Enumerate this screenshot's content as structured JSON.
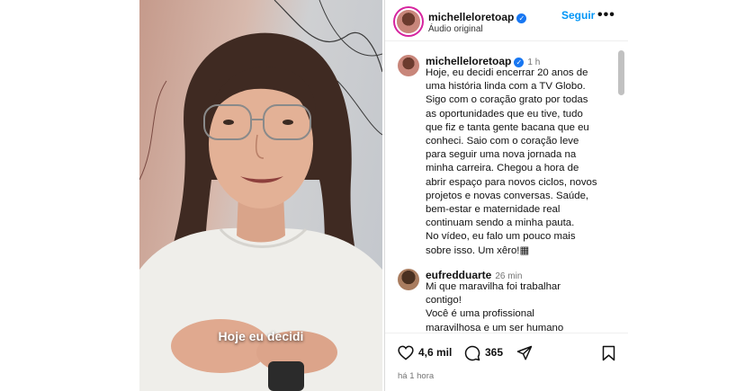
{
  "video": {
    "caption": "Hoje eu decidi"
  },
  "post": {
    "username": "michelleloretoap",
    "follow_label": "Seguir",
    "more_label": "•••",
    "audio_label": "Áudio original"
  },
  "caption": {
    "username": "michelleloretoap",
    "time": "1 h",
    "lines": [
      "Hoje, eu decidi encerrar 20 anos de",
      "uma história linda com a TV Globo.",
      "Sigo com o coração grato por todas",
      "as oportunidades que eu tive, tudo",
      "que fiz e tanta gente bacana que eu",
      "conheci. Saio com o coração leve",
      "para seguir uma nova jornada na",
      "minha carreira. Chegou a hora de",
      "abrir espaço para novos ciclos, novos",
      "projetos e novas conversas. Saúde,",
      "bem-estar e maternidade real",
      "continuam sendo a minha pauta.",
      "No vídeo, eu falo um pouco mais",
      "sobre isso. Um xêro!▦"
    ]
  },
  "comment": {
    "username": "eufredduarte",
    "time": "26 min",
    "lines": [
      "Mi que maravilha foi trabalhar",
      "contigo!",
      "Você é uma profissional",
      "maravilhosa e um ser humano"
    ]
  },
  "actions": {
    "likes": "4,6 mil",
    "comments": "365",
    "time_ago": "há 1 hora"
  },
  "colors": {
    "accent": "#0095f6",
    "verified": "#1877f2",
    "muted": "#737373"
  }
}
